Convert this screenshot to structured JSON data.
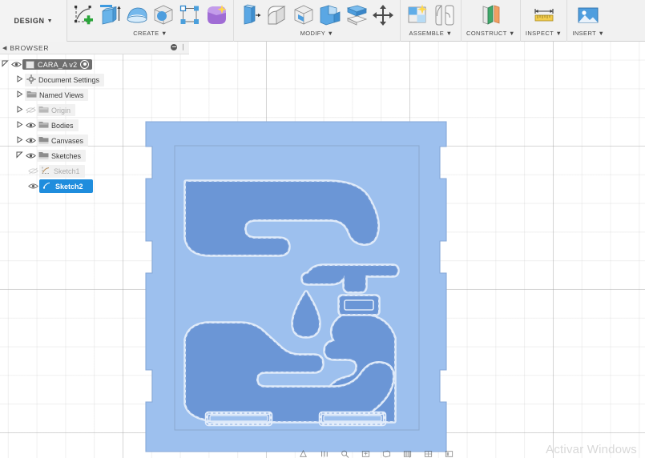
{
  "app": {
    "workspace_label": "DESIGN",
    "watermark": "Activar Windows"
  },
  "toolbar": {
    "groups": [
      {
        "name": "create",
        "label": "CREATE",
        "items": [
          {
            "label": "New Sketch",
            "icon": "sketch-plus-icon"
          },
          {
            "label": "Extrude",
            "icon": "extrude-icon"
          },
          {
            "label": "Revolve",
            "icon": "revolve-icon"
          },
          {
            "label": "Sphere",
            "icon": "sphere-icon"
          },
          {
            "label": "Pattern",
            "icon": "pattern-icon"
          },
          {
            "label": "Create Form",
            "icon": "create-form-icon"
          }
        ]
      },
      {
        "name": "modify",
        "label": "MODIFY",
        "items": [
          {
            "label": "Press Pull",
            "icon": "press-pull-icon"
          },
          {
            "label": "Fillet",
            "icon": "fillet-icon"
          },
          {
            "label": "Shell",
            "icon": "shell-icon"
          },
          {
            "label": "Combine",
            "icon": "combine-icon"
          },
          {
            "label": "Split Body",
            "icon": "split-body-icon"
          },
          {
            "label": "Move Copy",
            "icon": "move-copy-icon"
          }
        ]
      },
      {
        "name": "assemble",
        "label": "ASSEMBLE",
        "items": [
          {
            "label": "New Component",
            "icon": "new-component-icon"
          },
          {
            "label": "Joint",
            "icon": "joint-icon"
          }
        ]
      },
      {
        "name": "construct",
        "label": "CONSTRUCT",
        "items": [
          {
            "label": "Offset Plane",
            "icon": "offset-plane-icon"
          }
        ]
      },
      {
        "name": "inspect",
        "label": "INSPECT",
        "items": [
          {
            "label": "Measure",
            "icon": "measure-icon"
          }
        ]
      },
      {
        "name": "insert",
        "label": "INSERT",
        "items": [
          {
            "label": "Insert Canvas",
            "icon": "insert-image-icon"
          }
        ]
      }
    ]
  },
  "browser": {
    "title": "BROWSER",
    "collapse_icon": "left-caret-icon",
    "options_icon": "minus-circle-icon",
    "root": {
      "label": "CARA_A v2",
      "expander": "expanded-triangle-icon",
      "visibility_icon": "eye-icon",
      "doc_icon": "component-icon",
      "target_icon": "activate-target-icon"
    },
    "items": [
      {
        "label": "Document Settings",
        "icon": "gear-icon",
        "expander": "collapsed-triangle-icon",
        "visibility": "none",
        "dim": false,
        "indent": 1
      },
      {
        "label": "Named Views",
        "icon": "folder-icon",
        "expander": "collapsed-triangle-icon",
        "visibility": "none",
        "dim": false,
        "indent": 1
      },
      {
        "label": "Origin",
        "icon": "folder-icon",
        "expander": "collapsed-triangle-icon",
        "visibility": "eye-off-icon",
        "dim": true,
        "indent": 1
      },
      {
        "label": "Bodies",
        "icon": "folder-icon",
        "expander": "collapsed-triangle-icon",
        "visibility": "eye-icon",
        "dim": false,
        "indent": 1
      },
      {
        "label": "Canvases",
        "icon": "canvas-folder-icon",
        "expander": "collapsed-triangle-icon",
        "visibility": "eye-icon",
        "dim": false,
        "indent": 1
      },
      {
        "label": "Sketches",
        "icon": "sketch-folder-icon",
        "expander": "expanded-triangle-icon",
        "visibility": "eye-icon",
        "dim": false,
        "indent": 1
      },
      {
        "label": "Sketch1",
        "icon": "sketch-icon",
        "expander": "none",
        "visibility": "eye-off-icon",
        "dim": true,
        "indent": 2
      },
      {
        "label": "Sketch2",
        "icon": "sketch-icon",
        "expander": "none",
        "visibility": "eye-icon",
        "dim": false,
        "indent": 2,
        "selected": true
      }
    ]
  },
  "canvas": {
    "name": "sketch-viewport",
    "sketch_name": "Sketch2",
    "description": "Hand washing pictogram stencil sketch on rectangular plate with side tabs",
    "colors": {
      "plate_fill": "#9dc0ee",
      "shape_fill": "#6b96d6",
      "profile_outline": "#dce8fa",
      "grid_line": "#c9c9c9",
      "grid_major": "#9a9a9a",
      "background": "#ffffff",
      "selection": "#1f8ddd"
    },
    "elements": [
      {
        "name": "plate-outline",
        "type": "rectangle-with-tabs"
      },
      {
        "name": "inner-boundary-rectangle",
        "type": "rectangle"
      },
      {
        "name": "upper-hand-profile",
        "type": "closed-profile"
      },
      {
        "name": "lower-hand-profile",
        "type": "closed-profile"
      },
      {
        "name": "soap-dispenser-profile",
        "type": "closed-profile"
      },
      {
        "name": "dispenser-nozzle-profile",
        "type": "closed-profile"
      },
      {
        "name": "dispenser-label-slot",
        "type": "rounded-rectangle"
      },
      {
        "name": "water-droplet-profile",
        "type": "closed-profile"
      },
      {
        "name": "bottom-slot-left",
        "type": "rounded-rectangle"
      },
      {
        "name": "bottom-slot-right",
        "type": "rounded-rectangle"
      }
    ]
  },
  "statusbar": {
    "icons": [
      "orbit-icon",
      "pan-icon",
      "zoom-icon",
      "fit-icon",
      "display-settings-icon",
      "grid-snaps-icon",
      "viewports-icon",
      "layout-icon"
    ]
  }
}
